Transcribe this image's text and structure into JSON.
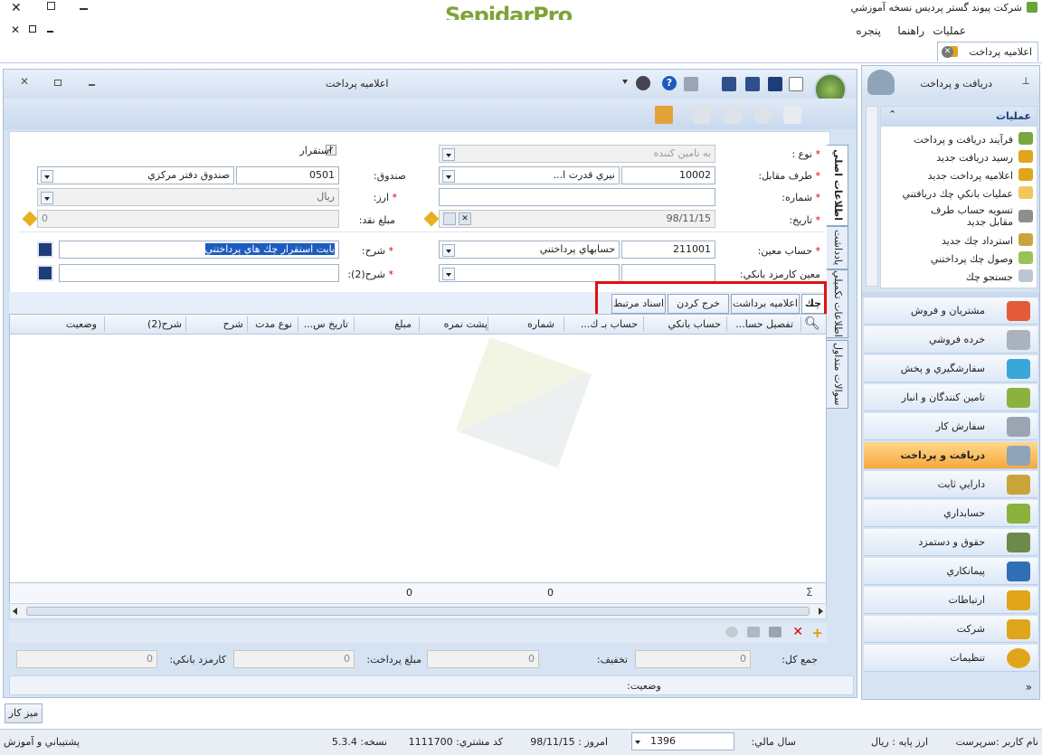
{
  "app": {
    "title": "شرکت پیوند گستر پردیس نسخه آموزشي",
    "logo": "SepidarPro"
  },
  "menu": {
    "items": [
      "عمليات",
      "راهنما",
      "پنجره"
    ]
  },
  "tab": {
    "label": "اعلاميه پرداخت"
  },
  "doc": {
    "title": "اعلاميه پرداخت"
  },
  "form": {
    "type_label": "نوع :",
    "type_value": "به تامين كننده",
    "party_label": "طرف مقابل:",
    "party_code": "10002",
    "party_name": "نيري قدرت ا...",
    "number_label": "شماره:",
    "number_value": "",
    "date_label": "تاريخ:",
    "date_value": "98/11/15",
    "fund_label": "صندوق:",
    "fund_code": "0501",
    "fund_name": "صندوق دفتر مرکزي",
    "currency_label": "ارز:",
    "currency_value": "ريال",
    "cash_label": "مبلغ نقد:",
    "cash_value": "0",
    "persist_label": "استقرار",
    "account_label": "حساب معين:",
    "account_code": "211001",
    "account_name": "حسابهاي پرداختني",
    "bank_fee_label": "معين كارمزد بانكي:",
    "desc_label": "شرح:",
    "desc_value": "بابت استقرار چك هاي پرداختني",
    "desc2_label": "شرح(2):"
  },
  "tabs": [
    "چك",
    "اعلاميه برداشت",
    "خرج كردن چك",
    "اسناد مرتبط"
  ],
  "grid": {
    "columns": [
      "تفصيل حسا...",
      "حساب بانكي",
      "حساب بـ ك...",
      "شماره",
      "پشت نمره",
      "مبلغ",
      "تاريخ س...",
      "نوع مدت",
      "شرح",
      "شرح(2)",
      "وضعيت"
    ],
    "footer": [
      "0",
      "0"
    ]
  },
  "vtabs": [
    "اطلاعات اصلي",
    "يادداشت",
    "اطلاعات تكميلي",
    "سوالات متداول"
  ],
  "totals": {
    "total_label": "جمع كل:",
    "total_value": "0",
    "discount_label": "تخفيف:",
    "discount_value": "0",
    "paid_label": "مبلغ پرداخت:",
    "paid_value": "0",
    "fee_label": "كارمزد بانكي:",
    "fee_value": "0"
  },
  "status": {
    "label": "وضعيت:"
  },
  "nav": {
    "title": "دريافت و پرداخت",
    "ops_header": "عمليات",
    "ops": [
      "فرآيند دريافت و پرداخت",
      "رسيد دريافت جديد",
      "اعلاميه پرداخت جديد",
      "عمليات بانكي چك دريافتني",
      "تسويه حساب طرف مقابل جديد",
      "استرداد چك جديد",
      "وصول چك پرداختني",
      "جستجو چك"
    ],
    "sections": [
      "مشتريان و فروش",
      "خرده فروشي",
      "سفارشگيري و پخش",
      "تامين كنندگان و انبار",
      "سفارش كار",
      "دريافت و پرداخت",
      "دارايي ثابت",
      "حسابداري",
      "حقوق و دستمزد",
      "پيمانكاري",
      "ارتباطات",
      "شركت",
      "تنظيمات"
    ]
  },
  "desk": "ميز كار",
  "statusbar": {
    "user": "نام كاربر :سرپرست",
    "base_currency": "ارز پايه :   ريال",
    "fiscal_label": "سال مالي:",
    "fiscal_value": "1396",
    "today": "امروز :   98/11/15",
    "customer": "كد مشتري:   1111700",
    "version": "نسخه:    5.3.4",
    "support": "پشتيباني و آموزش"
  },
  "colors": {
    "accent": "#f7a83c",
    "red": "#e01010",
    "panel": "#d6e3f3"
  }
}
